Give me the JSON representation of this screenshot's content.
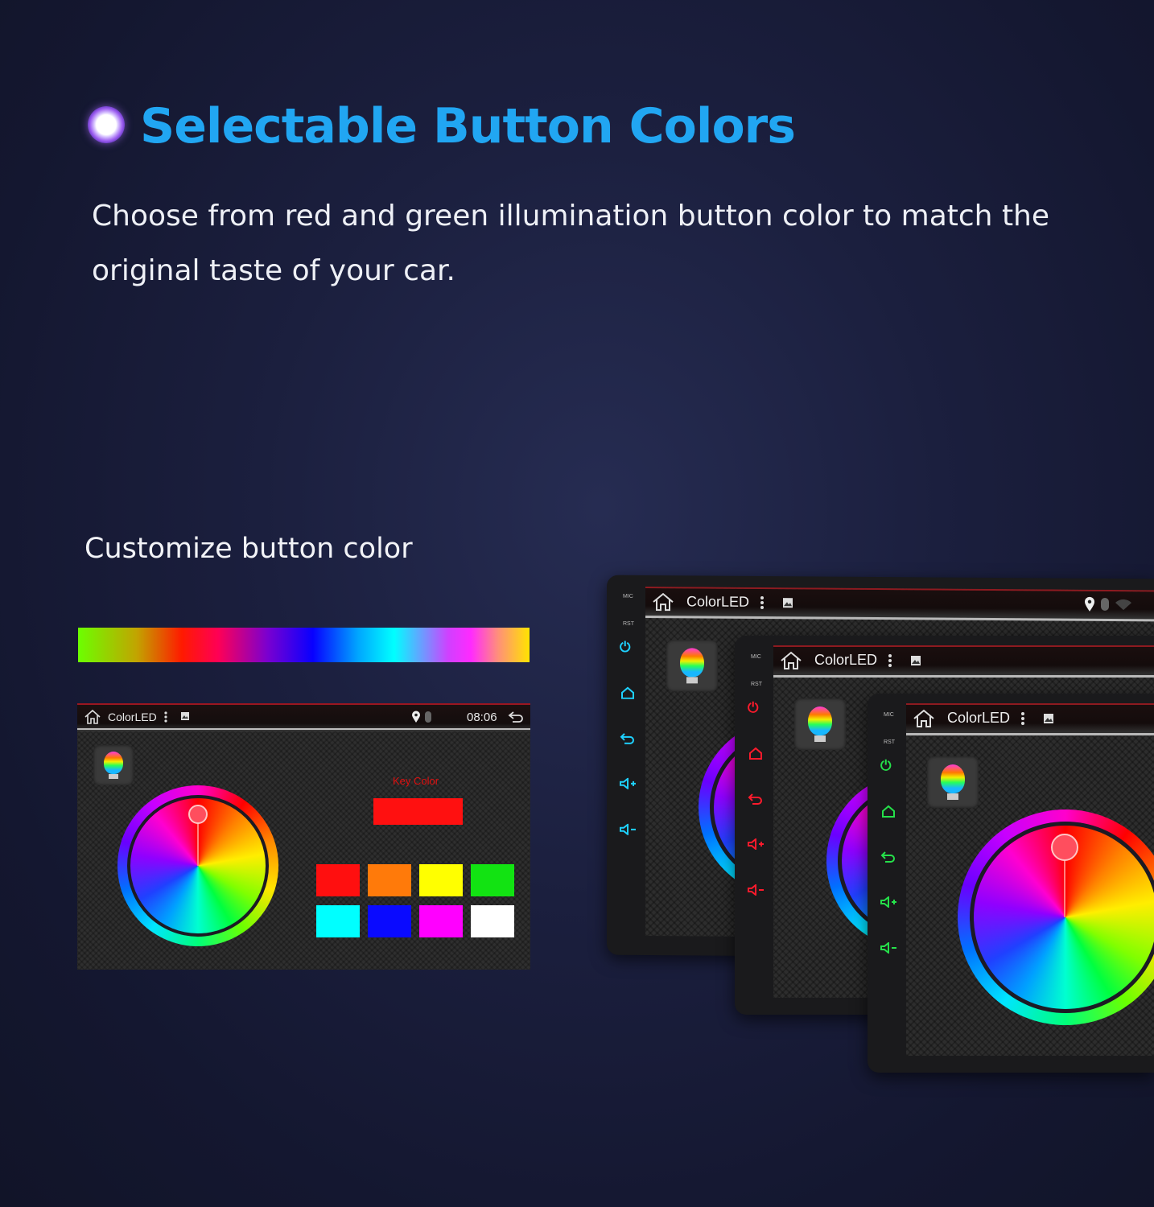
{
  "heading": {
    "title": "Selectable Button Colors",
    "description": "Choose from red and green illumination button color to match the original taste of your car."
  },
  "subheading": "Customize button color",
  "screen": {
    "app_name": "ColorLED",
    "time": "08:06",
    "key_color_label": "Key Color",
    "selected_key_color": "#ff1010",
    "swatches": [
      "#ff0f0f",
      "#ff7a0a",
      "#ffff00",
      "#12e312",
      "#00ffff",
      "#0a0aff",
      "#ff00ff",
      "#ffffff"
    ]
  },
  "device": {
    "app_name": "ColorLED",
    "mic_label": "MIC",
    "rst_label": "RST",
    "button_colors": [
      "#1ed1ff",
      "#ff1a2c",
      "#25e04a"
    ]
  },
  "icons": [
    "heading-ring-icon",
    "home-icon",
    "menu-dots-icon",
    "gallery-icon",
    "location-pin-icon",
    "bluetooth-icon",
    "wifi-icon",
    "back-icon",
    "bulb-icon",
    "power-icon",
    "volume-up-icon",
    "volume-down-icon"
  ]
}
